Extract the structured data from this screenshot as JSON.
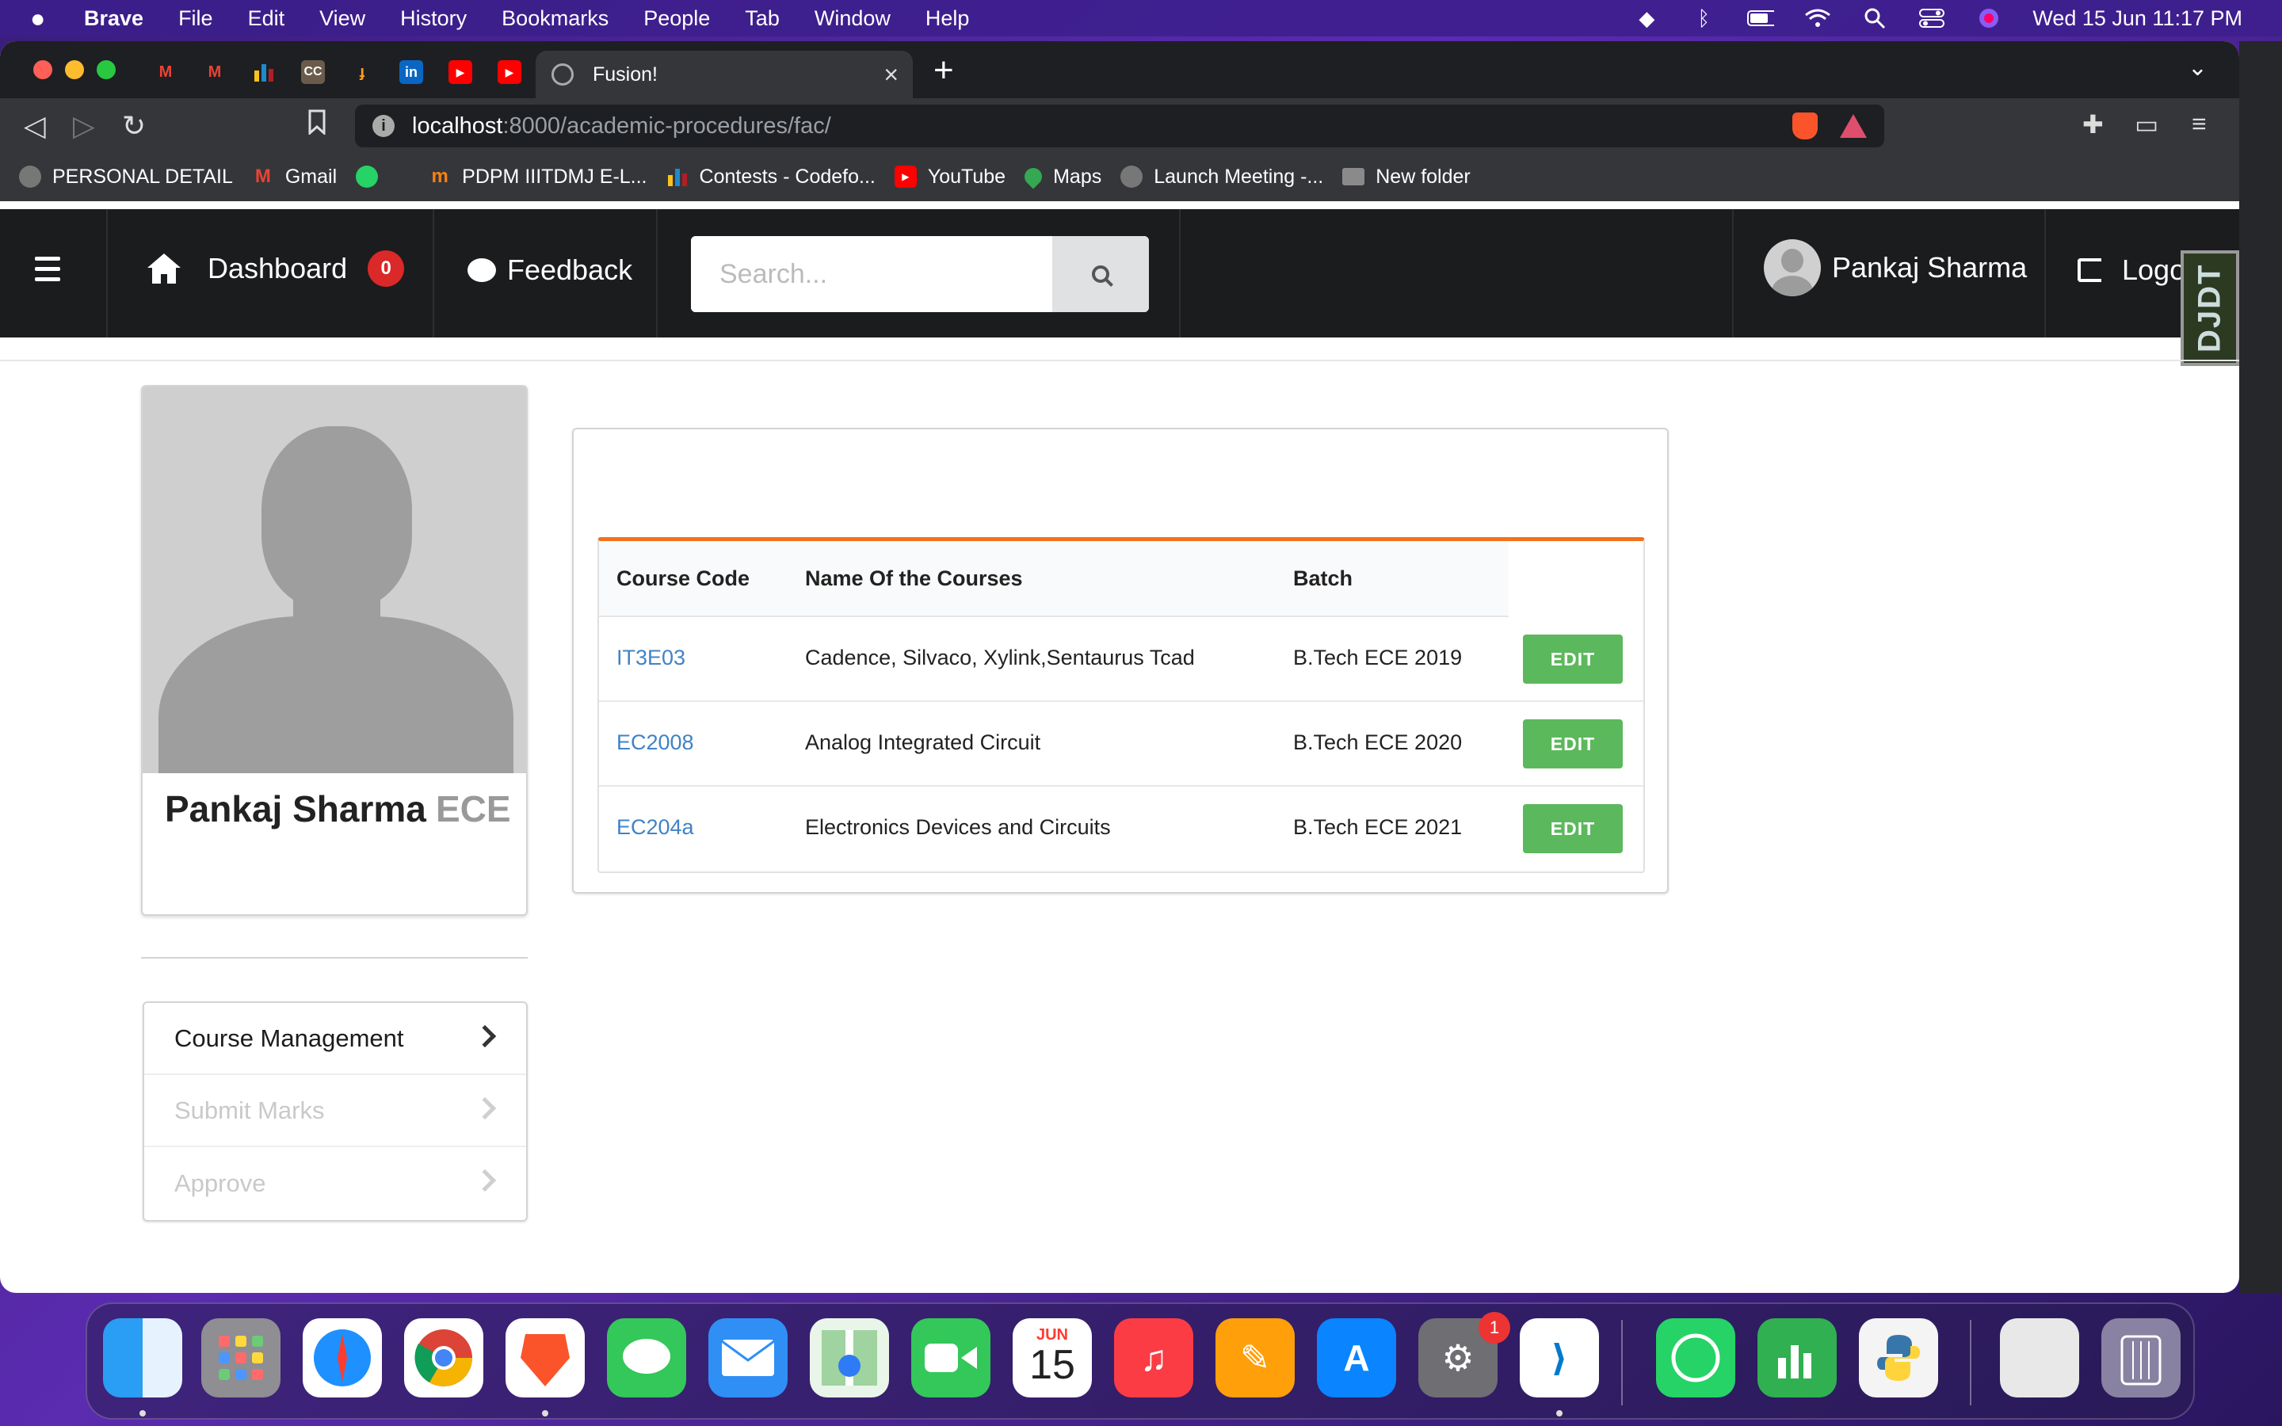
{
  "menubar": {
    "app": "Brave",
    "items": [
      "File",
      "Edit",
      "View",
      "History",
      "Bookmarks",
      "People",
      "Tab",
      "Window",
      "Help"
    ],
    "clock": "Wed 15 Jun  11:17 PM"
  },
  "browser": {
    "active_tab_title": "Fusion!",
    "url_host": "localhost",
    "url_path": ":8000/academic-procedures/fac/",
    "bookmarks": [
      {
        "label": "PERSONAL DETAIL",
        "icon": "globe-icon",
        "color": "#777777"
      },
      {
        "label": "Gmail",
        "icon": "gmail-icon",
        "color": "#ea4335"
      },
      {
        "label": "",
        "icon": "whatsapp-icon",
        "color": "#25d366"
      },
      {
        "label": "PDPM IIITDMJ E-L...",
        "icon": "moodle-icon",
        "color": "#f98012"
      },
      {
        "label": "Contests - Codefo...",
        "icon": "codeforces-icon",
        "color": "#1f8acb"
      },
      {
        "label": "YouTube",
        "icon": "youtube-icon",
        "color": "#ff0000"
      },
      {
        "label": "Maps",
        "icon": "maps-pin-icon",
        "color": "#34a853"
      },
      {
        "label": "Launch Meeting -...",
        "icon": "globe-icon",
        "color": "#777777"
      },
      {
        "label": "New folder",
        "icon": "folder-icon",
        "color": "#8a8a8a"
      }
    ]
  },
  "navbar": {
    "dashboard_label": "Dashboard",
    "notification_count": "0",
    "feedback_label": "Feedback",
    "search_placeholder": "Search...",
    "user_name": "Pankaj Sharma",
    "logout_label": "Logout",
    "debug_toolbar_label": "DJDT"
  },
  "profile": {
    "name": "Pankaj Sharma",
    "department": "ECE"
  },
  "side_menu": {
    "items": [
      {
        "label": "Course Management"
      },
      {
        "label": "Submit Marks"
      },
      {
        "label": "Approve"
      }
    ]
  },
  "courses": {
    "headers": {
      "code": "Course Code",
      "name": "Name Of the Courses",
      "batch": "Batch"
    },
    "rows": [
      {
        "code": "IT3E03",
        "name": "Cadence, Silvaco, Xylink,Sentaurus Tcad",
        "batch": "B.Tech ECE 2019",
        "action": "EDIT"
      },
      {
        "code": "EC2008",
        "name": "Analog Integrated Circuit",
        "batch": "B.Tech ECE 2020",
        "action": "EDIT"
      },
      {
        "code": "EC204a",
        "name": "Electronics Devices and Circuits",
        "batch": "B.Tech ECE 2021",
        "action": "EDIT"
      }
    ]
  },
  "dock": {
    "calendar_month": "JUN",
    "calendar_day": "15",
    "settings_badge": "1"
  },
  "colors": {
    "accent_orange": "#f2711c",
    "edit_green": "#5cb85c",
    "link_blue": "#4183c4",
    "badge_red": "#db2828"
  }
}
